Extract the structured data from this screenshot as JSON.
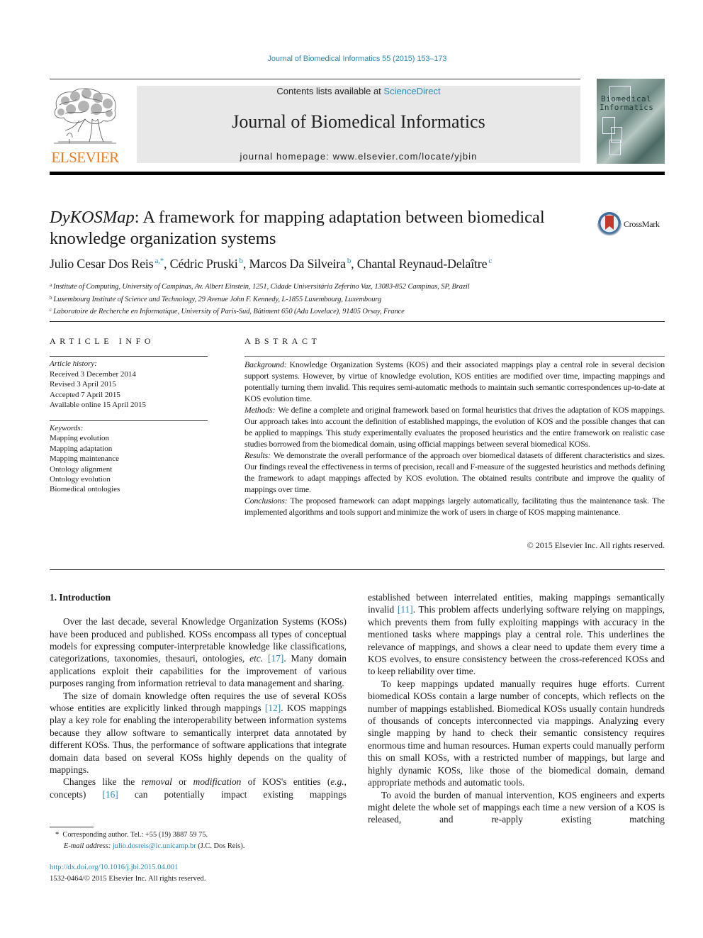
{
  "journal_reference": "Journal of Biomedical Informatics 55 (2015) 153–173",
  "masthead": {
    "publisher_logo_text": "ELSEVIER",
    "contents_prefix": "Contents lists available at ",
    "contents_link": "ScienceDirect",
    "journal_name": "Journal of Biomedical Informatics",
    "homepage": "journal homepage: www.elsevier.com/locate/yjbin",
    "cover_title_line1": "Biomedical",
    "cover_title_line2": "Informatics"
  },
  "article": {
    "title_italic": "DyKOSMap",
    "title_rest": ": A framework for mapping adaptation between biomedical knowledge organization systems",
    "crossmark_label": "CrossMark",
    "authors": [
      {
        "name": "Julio Cesar Dos Reis",
        "sup": "a,*"
      },
      {
        "name": "Cédric Pruski",
        "sup": "b"
      },
      {
        "name": "Marcos Da Silveira",
        "sup": "b"
      },
      {
        "name": "Chantal Reynaud-Delaître",
        "sup": "c"
      }
    ],
    "affiliations": [
      {
        "key": "a",
        "text": "Institute of Computing, University of Campinas, Av. Albert Einstein, 1251, Cidade Universitária Zeferino Vaz, 13083-852 Campinas, SP, Brazil"
      },
      {
        "key": "b",
        "text": "Luxembourg Institute of Science and Technology, 29 Avenue John F. Kennedy, L-1855 Luxembourg, Luxembourg"
      },
      {
        "key": "c",
        "text": "Laboratoire de Recherche en Informatique, University of Paris-Sud, Bâtiment 650 (Ada Lovelace), 91405 Orsay, France"
      }
    ]
  },
  "article_info": {
    "heading": "ARTICLE INFO",
    "history_heading": "Article history:",
    "history": [
      "Received 3 December 2014",
      "Revised 3 April 2015",
      "Accepted 7 April 2015",
      "Available online 15 April 2015"
    ],
    "keywords_heading": "Keywords:",
    "keywords": [
      "Mapping evolution",
      "Mapping adaptation",
      "Mapping maintenance",
      "Ontology alignment",
      "Ontology evolution",
      "Biomedical ontologies"
    ]
  },
  "abstract": {
    "heading": "ABSTRACT",
    "sections": [
      {
        "label": "Background:",
        "text": "Knowledge Organization Systems (KOS) and their associated mappings play a central role in several decision support systems. However, by virtue of knowledge evolution, KOS entities are modified over time, impacting mappings and potentially turning them invalid. This requires semi-automatic methods to maintain such semantic correspondences up-to-date at KOS evolution time."
      },
      {
        "label": "Methods:",
        "text": "We define a complete and original framework based on formal heuristics that drives the adaptation of KOS mappings. Our approach takes into account the definition of established mappings, the evolution of KOS and the possible changes that can be applied to mappings. This study experimentally evaluates the proposed heuristics and the entire framework on realistic case studies borrowed from the biomedical domain, using official mappings between several biomedical KOSs."
      },
      {
        "label": "Results:",
        "text": "We demonstrate the overall performance of the approach over biomedical datasets of different characteristics and sizes. Our findings reveal the effectiveness in terms of precision, recall and F-measure of the suggested heuristics and methods defining the framework to adapt mappings affected by KOS evolution. The obtained results contribute and improve the quality of mappings over time."
      },
      {
        "label": "Conclusions:",
        "text": "The proposed framework can adapt mappings largely automatically, facilitating thus the maintenance task. The implemented algorithms and tools support and minimize the work of users in charge of KOS mapping maintenance."
      }
    ],
    "copyright": "© 2015 Elsevier Inc. All rights reserved."
  },
  "body": {
    "section_heading": "1. Introduction",
    "left_paragraphs": [
      {
        "parts": [
          {
            "t": "Over the last decade, several Knowledge Organization Systems (KOSs) have been produced and published. KOSs encompass all types of conceptual models for expressing computer-interpretable knowledge like classifications, categorizations, taxonomies, thesauri, ontologies, "
          },
          {
            "t": "etc.",
            "style": "italic"
          },
          {
            "t": " "
          },
          {
            "t": "[17]",
            "style": "link"
          },
          {
            "t": ". Many domain applications exploit their capabilities for the improvement of various purposes ranging from information retrieval to data management and sharing."
          }
        ]
      },
      {
        "parts": [
          {
            "t": "The size of domain knowledge often requires the use of several KOSs whose entities are explicitly linked through mappings "
          },
          {
            "t": "[12]",
            "style": "link"
          },
          {
            "t": ". KOS mappings play a key role for enabling the interoperability between information systems because they allow software to semantically interpret data annotated by different KOSs. Thus, the performance of software applications that integrate domain data based on several KOSs highly depends on the quality of mappings."
          }
        ]
      },
      {
        "parts": [
          {
            "t": "Changes like the "
          },
          {
            "t": "removal",
            "style": "italic"
          },
          {
            "t": " or "
          },
          {
            "t": "modification",
            "style": "italic"
          },
          {
            "t": " of KOS's entities ("
          },
          {
            "t": "e.g.",
            "style": "italic"
          },
          {
            "t": ", concepts) "
          },
          {
            "t": "[16]",
            "style": "link"
          },
          {
            "t": " can potentially impact existing mappings"
          }
        ],
        "continues": true
      }
    ],
    "right_paragraphs": [
      {
        "parts": [
          {
            "t": "established between interrelated entities, making mappings semantically invalid "
          },
          {
            "t": "[11]",
            "style": "link"
          },
          {
            "t": ". This problem affects underlying software relying on mappings, which prevents them from fully exploiting mappings with accuracy in the mentioned tasks where mappings play a central role. This underlines the relevance of mappings, and shows a clear need to update them every time a KOS evolves, to ensure consistency between the cross-referenced KOSs and to keep reliability over time."
          }
        ],
        "noindent": true
      },
      {
        "parts": [
          {
            "t": "To keep mappings updated manually requires huge efforts. Current biomedical KOSs contain a large number of concepts, which reflects on the number of mappings established. Biomedical KOSs usually contain hundreds of thousands of concepts interconnected via mappings. Analyzing every single mapping by hand to check their semantic consistency requires enormous time and human resources. Human experts could manually perform this on small KOSs, with a restricted number of mappings, but large and highly dynamic KOSs, like those of the biomedical domain, demand appropriate methods and automatic tools."
          }
        ]
      },
      {
        "parts": [
          {
            "t": "To avoid the burden of manual intervention, KOS engineers and experts might delete the whole set of mappings each time a new version of a KOS is released, and re-apply existing matching"
          }
        ],
        "continues": true
      }
    ]
  },
  "footnote": {
    "marker": "*",
    "corresponding": "Corresponding author. Tel.: +55 (19) 3887 59 75.",
    "email_label": "E-mail address:",
    "email": "julio.dosreis@ic.unicamp.br",
    "email_owner": "(J.C. Dos Reis)."
  },
  "doi": {
    "url": "http://dx.doi.org/10.1016/j.jbi.2015.04.001",
    "issn_line": "1532-0464/© 2015 Elsevier Inc. All rights reserved."
  },
  "colors": {
    "link": "#2a8ab8",
    "elsevier_orange": "#f07a1c",
    "masthead_bg": "#e8e8e8"
  }
}
